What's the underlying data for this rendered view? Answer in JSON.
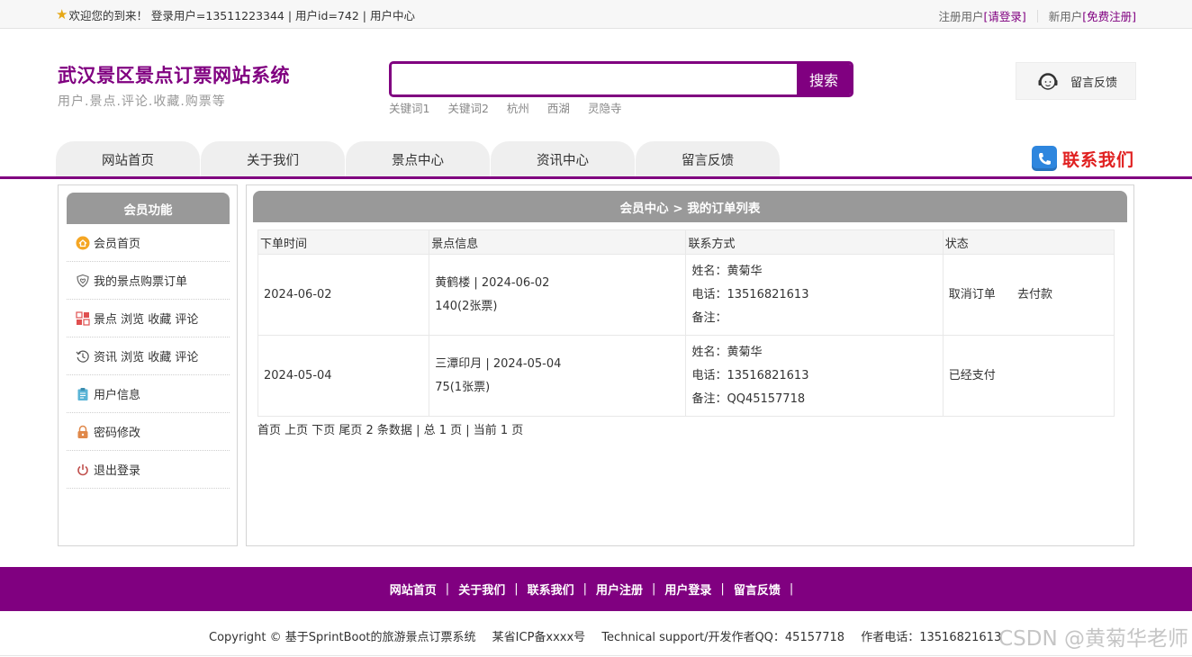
{
  "topbar": {
    "welcome": "欢迎您的到来！ 登录用户=13511223344 | 用户id=742 | 用户中心",
    "register_prefix": "注册用户",
    "login_link": "[请登录]",
    "newuser_prefix": "新用户",
    "free_register_link": "[免费注册]"
  },
  "brand": {
    "name": "武汉景区景点订票网站系统",
    "slogan": "用户.景点.评论.收藏.购票等"
  },
  "search": {
    "value": "",
    "button": "搜索",
    "keywords": [
      "关键词1",
      "关键词2",
      "杭州",
      "西湖",
      "灵隐寺"
    ]
  },
  "feedback_box": {
    "label": "留言反馈"
  },
  "nav": [
    "网站首页",
    "关于我们",
    "景点中心",
    "资讯中心",
    "留言反馈"
  ],
  "contact": {
    "label": "联系我们"
  },
  "sidebar": {
    "title": "会员功能",
    "items": [
      {
        "label": "会员首页",
        "icon": "home-icon"
      },
      {
        "label": "我的景点购票订单",
        "icon": "shield-heart-icon"
      },
      {
        "label": "景点 浏览 收藏 评论",
        "icon": "grid-icon"
      },
      {
        "label": "资讯 浏览 收藏 评论",
        "icon": "history-icon"
      },
      {
        "label": "用户信息",
        "icon": "clipboard-icon"
      },
      {
        "label": "密码修改",
        "icon": "lock-icon"
      },
      {
        "label": "退出登录",
        "icon": "power-icon"
      }
    ]
  },
  "main": {
    "title": "会员中心 > 我的订单列表",
    "columns": [
      "下单时间",
      "景点信息",
      "联系方式",
      "状态"
    ],
    "rows": [
      {
        "date": "2024-06-02",
        "spot_line1": "黄鹤楼 | 2024-06-02",
        "spot_line2": "140(2张票)",
        "name": "姓名：黄菊华",
        "phone": "电话：13516821613",
        "note": "备注：",
        "status": "",
        "actions": [
          "取消订单",
          "去付款"
        ]
      },
      {
        "date": "2024-05-04",
        "spot_line1": "三潭印月 | 2024-05-04",
        "spot_line2": "75(1张票)",
        "name": "姓名：黄菊华",
        "phone": "电话：13516821613",
        "note": "备注：QQ45157718",
        "status": "已经支付",
        "actions": []
      }
    ],
    "pager": "首页 上页 下页 尾页 2 条数据 | 总 1 页 | 当前 1 页"
  },
  "footer": {
    "links": [
      "网站首页",
      "关于我们",
      "联系我们",
      "用户注册",
      "用户登录",
      "留言反馈"
    ]
  },
  "copyright": {
    "text": "Copyright © 基于SprintBoot的旅游景点订票系统",
    "icp": "某省ICP备xxxx号",
    "support": "Technical support/开发作者QQ：45157718",
    "phone": "作者电话：13516821613"
  },
  "watermark": "CSDN @黄菊华老师",
  "colors": {
    "brand": "#800080",
    "contact": "#e02020",
    "panel_head": "#999999"
  }
}
